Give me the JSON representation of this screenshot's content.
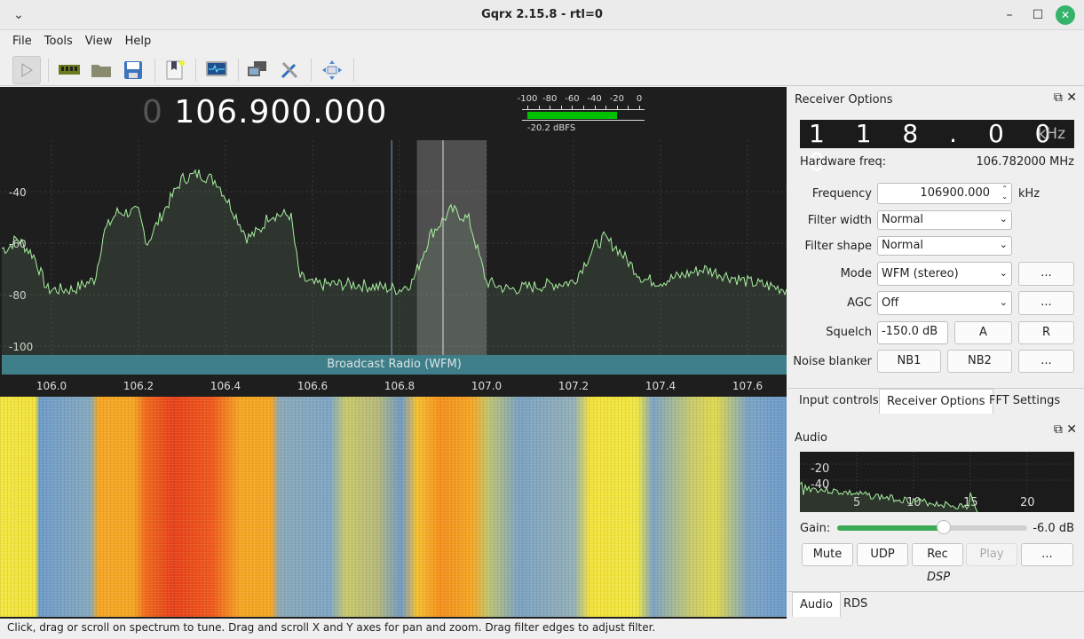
{
  "window": {
    "title": "Gqrx 2.15.8 - rtl=0",
    "menu_icon": "chevron-down-icon",
    "min_icon": "minimize-icon",
    "max_icon": "maximize-icon",
    "close_icon": "close-icon"
  },
  "menu": [
    "File",
    "Tools",
    "View",
    "Help"
  ],
  "toolbar": [
    "play-icon",
    "hardware-icon",
    "open-folder-icon",
    "save-icon",
    "bookmark-icon",
    "monitor-icon",
    "network-icon",
    "tools-icon",
    "fullscreen-icon"
  ],
  "main": {
    "freq_prefix": "0",
    "freq": "106.900.000",
    "meter": {
      "ticks": [
        "-100",
        "-80",
        "-60",
        "-40",
        "-20",
        "0"
      ],
      "value_dbfs": -20.2,
      "label": "-20.2 dBFS",
      "color": "#00c000"
    },
    "spectrum": {
      "y_ticks": [
        "-40",
        "-60",
        "-80",
        "-100"
      ],
      "x_ticks": [
        "106.0",
        "106.2",
        "106.4",
        "106.6",
        "106.8",
        "107.0",
        "107.2",
        "107.4",
        "107.6"
      ],
      "center_mhz": 106.9,
      "filter_mhz": [
        106.84,
        107.0
      ],
      "line_color": "#a8f0a0",
      "trace": [
        [
          105.9,
          -62
        ],
        [
          105.92,
          -58
        ],
        [
          105.96,
          -65
        ],
        [
          105.99,
          -78
        ],
        [
          106.05,
          -78
        ],
        [
          106.1,
          -74
        ],
        [
          106.12,
          -56
        ],
        [
          106.15,
          -48
        ],
        [
          106.2,
          -48
        ],
        [
          106.22,
          -60
        ],
        [
          106.25,
          -50
        ],
        [
          106.3,
          -35
        ],
        [
          106.34,
          -33
        ],
        [
          106.38,
          -36
        ],
        [
          106.42,
          -48
        ],
        [
          106.45,
          -58
        ],
        [
          106.48,
          -55
        ],
        [
          106.5,
          -49
        ],
        [
          106.55,
          -49
        ],
        [
          106.57,
          -73
        ],
        [
          106.6,
          -76
        ],
        [
          106.7,
          -76
        ],
        [
          106.8,
          -78
        ],
        [
          106.83,
          -75
        ],
        [
          106.87,
          -57
        ],
        [
          106.92,
          -47
        ],
        [
          106.96,
          -51
        ],
        [
          107.0,
          -75
        ],
        [
          107.05,
          -78
        ],
        [
          107.2,
          -75
        ],
        [
          107.25,
          -61
        ],
        [
          107.27,
          -58
        ],
        [
          107.3,
          -62
        ],
        [
          107.36,
          -74
        ],
        [
          107.4,
          -75
        ],
        [
          107.5,
          -70
        ],
        [
          107.6,
          -75
        ],
        [
          107.69,
          -78
        ]
      ]
    },
    "band_label": "Broadcast Radio (WFM)"
  },
  "status": "Click, drag or scroll on spectrum to tune. Drag and scroll X and Y axes for pan and zoom. Drag filter edges to adjust filter.",
  "receiver": {
    "title": "Receiver Options",
    "float_icon": "float-icon",
    "close_icon": "close-icon",
    "offset": "1 1 8 . 0 0 0",
    "offset_unit": "kHz",
    "hw_label": "Hardware freq:",
    "hw_value": "106.782000 MHz",
    "freq_label": "Frequency",
    "freq_value": "106900.000",
    "freq_unit": "kHz",
    "fw_label": "Filter width",
    "fw_value": "Normal",
    "fs_label": "Filter shape",
    "fs_value": "Normal",
    "mode_label": "Mode",
    "mode_value": "WFM (stereo)",
    "mode_more": "...",
    "agc_label": "AGC",
    "agc_value": "Off",
    "agc_more": "...",
    "sq_label": "Squelch",
    "sq_value": "-150.0 dB",
    "sq_a": "A",
    "sq_r": "R",
    "nb_label": "Noise blanker",
    "nb1": "NB1",
    "nb2": "NB2",
    "nb_more": "..."
  },
  "tabs": [
    "Input controls",
    "Receiver Options",
    "FFT Settings"
  ],
  "audio": {
    "title": "Audio",
    "y_ticks": [
      "-20",
      "-40"
    ],
    "x_ticks": [
      "5",
      "10",
      "15",
      "20"
    ],
    "gain_label": "Gain:",
    "gain_db": -6.0,
    "gain_text": "-6.0 dB",
    "gain_fraction": 0.56,
    "buttons": [
      "Mute",
      "UDP",
      "Rec",
      "Play",
      "..."
    ],
    "dsp": "DSP"
  },
  "bottom_tabs": [
    "Audio",
    "RDS"
  ]
}
